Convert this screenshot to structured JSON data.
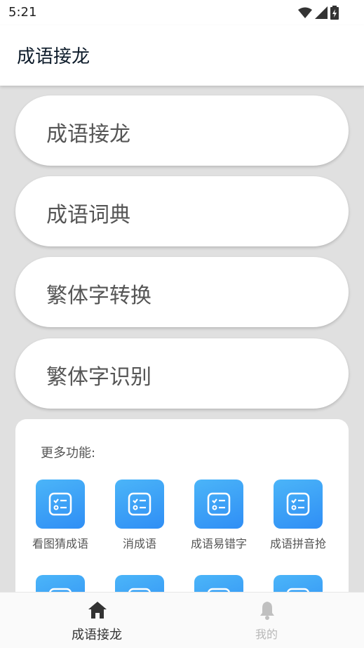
{
  "status_bar": {
    "time": "5:21"
  },
  "app_bar": {
    "title": "成语接龙"
  },
  "menu": [
    {
      "label": "成语接龙"
    },
    {
      "label": "成语词典"
    },
    {
      "label": "繁体字转换"
    },
    {
      "label": "繁体字识别"
    }
  ],
  "more": {
    "title": "更多功能:",
    "features": [
      {
        "label": "看图猜成语",
        "icon": "checklist-icon"
      },
      {
        "label": "消成语",
        "icon": "checklist-icon"
      },
      {
        "label": "成语易错字",
        "icon": "checklist-icon"
      },
      {
        "label": "成语拼音抢",
        "icon": "checklist-icon"
      },
      {
        "label": "",
        "icon": "checklist-icon"
      },
      {
        "label": "",
        "icon": "checklist-icon"
      },
      {
        "label": "",
        "icon": "checklist-icon"
      },
      {
        "label": "",
        "icon": "checklist-icon"
      }
    ]
  },
  "bottom_nav": {
    "items": [
      {
        "label": "成语接龙",
        "icon": "home-icon",
        "active": true
      },
      {
        "label": "我的",
        "icon": "bell-icon",
        "active": false
      }
    ]
  },
  "colors": {
    "accent_blue": "#2f8ef5",
    "active_nav": "#333333",
    "inactive_nav": "#c0c0c0"
  }
}
